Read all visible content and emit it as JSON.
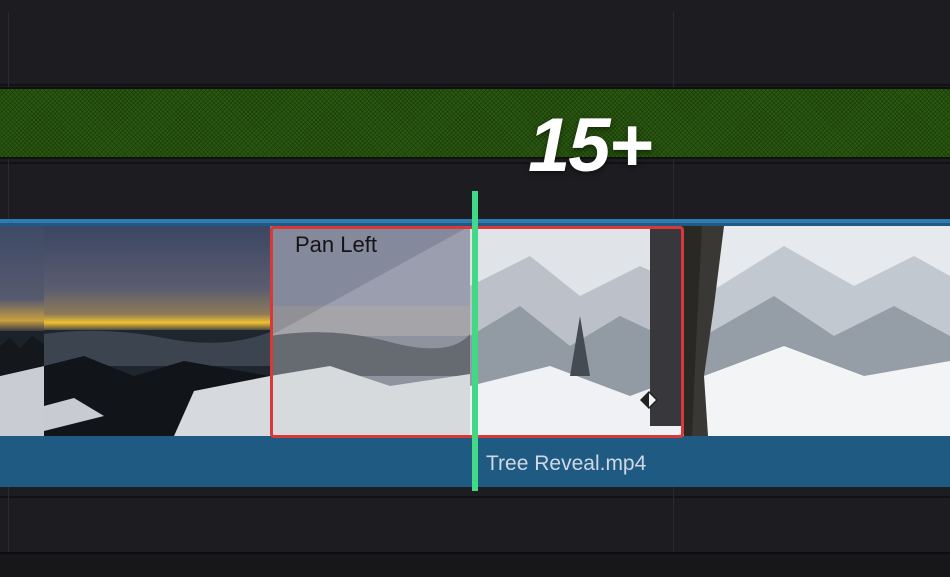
{
  "overlay": {
    "badge_text": "15+"
  },
  "timeline": {
    "effect": {
      "label": "Pan Left"
    },
    "clip": {
      "filename": "Tree Reveal.mp4"
    }
  },
  "colors": {
    "background": "#1d1d21",
    "audio_track": "#2a5a10",
    "video_clip": "#1f5a82",
    "effect_border": "#d8383a",
    "playhead": "#41d986"
  },
  "icons": {
    "keyframe": "diamond-keyframe-icon"
  }
}
